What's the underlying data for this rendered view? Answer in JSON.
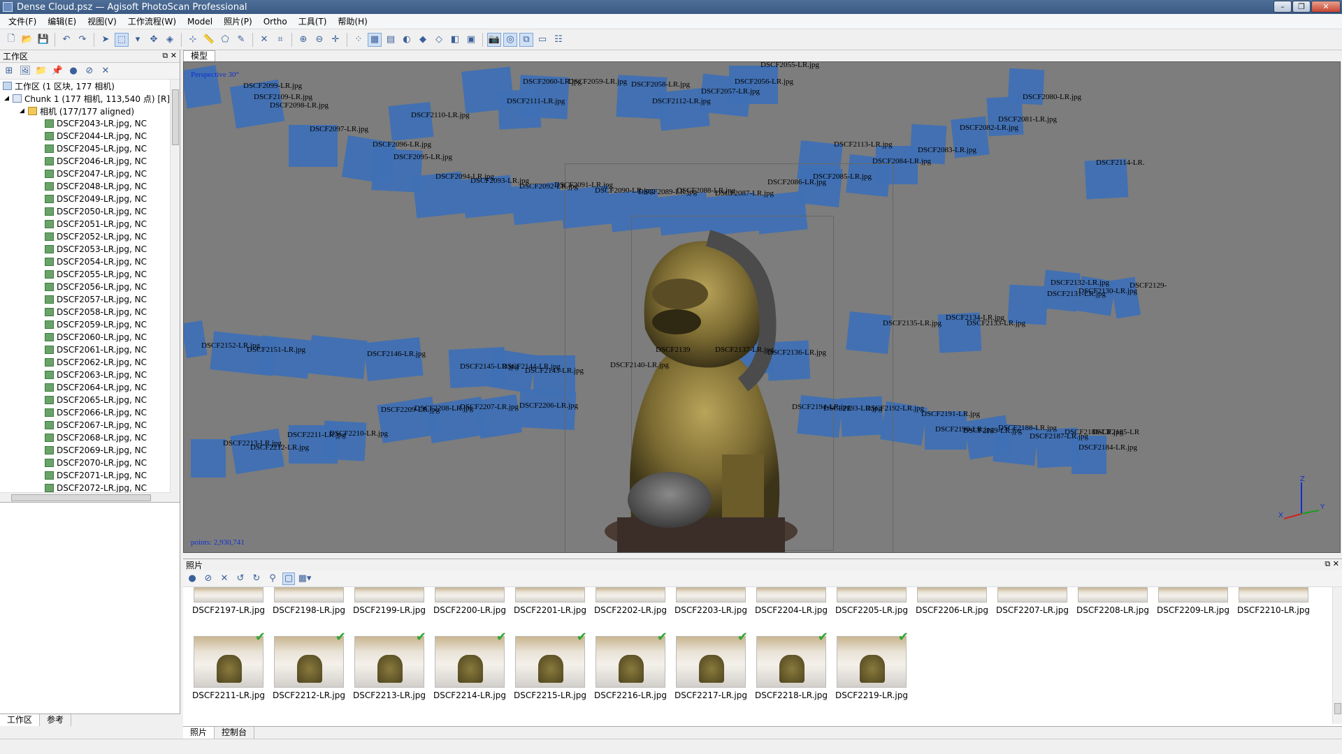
{
  "window": {
    "title": "Dense Cloud.psz — Agisoft PhotoScan Professional"
  },
  "menu": [
    "文件(F)",
    "编辑(E)",
    "视图(V)",
    "工作流程(W)",
    "Model",
    "照片(P)",
    "Ortho",
    "工具(T)",
    "帮助(H)"
  ],
  "workspace": {
    "title": "工作区",
    "root_label": "工作区 (1 区块, 177 相机)",
    "chunk_label": "Chunk 1 (177 相机, 113,540 点) [R]",
    "cameras_label": "相机 (177/177 aligned)",
    "cameras": [
      "DSCF2043-LR.jpg, NC",
      "DSCF2044-LR.jpg, NC",
      "DSCF2045-LR.jpg, NC",
      "DSCF2046-LR.jpg, NC",
      "DSCF2047-LR.jpg, NC",
      "DSCF2048-LR.jpg, NC",
      "DSCF2049-LR.jpg, NC",
      "DSCF2050-LR.jpg, NC",
      "DSCF2051-LR.jpg, NC",
      "DSCF2052-LR.jpg, NC",
      "DSCF2053-LR.jpg, NC",
      "DSCF2054-LR.jpg, NC",
      "DSCF2055-LR.jpg, NC",
      "DSCF2056-LR.jpg, NC",
      "DSCF2057-LR.jpg, NC",
      "DSCF2058-LR.jpg, NC",
      "DSCF2059-LR.jpg, NC",
      "DSCF2060-LR.jpg, NC",
      "DSCF2061-LR.jpg, NC",
      "DSCF2062-LR.jpg, NC",
      "DSCF2063-LR.jpg, NC",
      "DSCF2064-LR.jpg, NC",
      "DSCF2065-LR.jpg, NC",
      "DSCF2066-LR.jpg, NC",
      "DSCF2067-LR.jpg, NC",
      "DSCF2068-LR.jpg, NC",
      "DSCF2069-LR.jpg, NC",
      "DSCF2070-LR.jpg, NC",
      "DSCF2071-LR.jpg, NC",
      "DSCF2072-LR.jpg, NC"
    ],
    "tabs": [
      "工作区",
      "参考"
    ]
  },
  "model_view": {
    "tab": "模型",
    "perspective": "Perspective 30°",
    "points": "points: 2,930,741",
    "axis_labels": [
      "Z",
      "Y",
      "X"
    ],
    "camera_labels": [
      "DSCF2099-LR.jpg",
      "DSCF2109-LR.jpg",
      "DSCF2098-LR.jpg",
      "DSCF2110-LR.jpg",
      "DSCF2097-LR.jpg",
      "DSCF2096-LR.jpg",
      "DSCF2095-LR.jpg",
      "DSCF2094-LR.jpg",
      "DSCF2093-LR.jpg",
      "DSCF2092-LR.jpg",
      "DSCF2091-LR.jpg",
      "DSCF2090-LR.jpg",
      "DSCF2089-LR.jpg",
      "DSCF2088-LR.jpg",
      "DSCF2087-LR.jpg",
      "DSCF2060-LR.jpg",
      "DSCF2059-LR.jpg",
      "DSCF2111-LR.jpg",
      "DSCF2058-LR.jpg",
      "DSCF2112-LR.jpg",
      "DSCF2057-LR.jpg",
      "DSCF2056-LR.jpg",
      "DSCF2055-LR.jpg",
      "DSCF2080-LR.jpg",
      "DSCF2081-LR.jpg",
      "DSCF2082-LR.jpg",
      "DSCF2113-LR.jpg",
      "DSCF2083-LR.jpg",
      "DSCF2084-LR.jpg",
      "DSCF2085-LR.jpg",
      "DSCF2086-LR.jpg",
      "DSCF2114-LR.",
      "DSCF2132-LR.jpg",
      "DSCF2131-LR.jpg",
      "DSCF2130-LR.jpg",
      "DSCF2129-",
      "DSCF2134-LR.jpg",
      "DSCF2135-LR.jpg",
      "DSCF2133-LR.jpg",
      "DSCF2152-LR.jpg",
      "DSCF2151-LR.jpg",
      "DSCF2146-LR.jpg",
      "DSCF2145-LR.jpg",
      "DSCF2144-LR.jpg",
      "DSCF2143-LR.jpg",
      "DSCF2140-LR.jpg",
      "DSCF2139",
      "DSCF2137-LR.jpg",
      "DSCF2136-LR.jpg",
      "DSCF2207-LR.jpg",
      "DSCF2208-LR.jpg",
      "DSCF2209-LR.jpg",
      "DSCF2206-LR.jpg",
      "DSCF2194-LR.jpg",
      "DSCF2193-LR.jpg",
      "DSCF2192-LR.jpg",
      "DSCF2191-LR.jpg",
      "DSCF2190-LR.jpg",
      "DSCF2189-LR.jpg",
      "DSCF2188-LR.jpg",
      "DSCF2187-LR.jpg",
      "DSCF2186-LR.jpg",
      "DSCF2185-LR",
      "DSCF2184-LR.jpg",
      "DSCF2211-LR.jpg",
      "DSCF2210-LR.jpg",
      "DSCF2213-LR.jpg",
      "DSCF2212-LR.jpg"
    ]
  },
  "photos": {
    "title": "照片",
    "row1": [
      "DSCF2197-LR.jpg",
      "DSCF2198-LR.jpg",
      "DSCF2199-LR.jpg",
      "DSCF2200-LR.jpg",
      "DSCF2201-LR.jpg",
      "DSCF2202-LR.jpg",
      "DSCF2203-LR.jpg",
      "DSCF2204-LR.jpg",
      "DSCF2205-LR.jpg",
      "DSCF2206-LR.jpg",
      "DSCF2207-LR.jpg",
      "DSCF2208-LR.jpg",
      "DSCF2209-LR.jpg",
      "DSCF2210-LR.jpg"
    ],
    "row2": [
      "DSCF2211-LR.jpg",
      "DSCF2212-LR.jpg",
      "DSCF2213-LR.jpg",
      "DSCF2214-LR.jpg",
      "DSCF2215-LR.jpg",
      "DSCF2216-LR.jpg",
      "DSCF2217-LR.jpg",
      "DSCF2218-LR.jpg",
      "DSCF2219-LR.jpg"
    ],
    "tabs": [
      "照片",
      "控制台"
    ]
  },
  "colors": {
    "camera_plane": "#3f70b5",
    "viewport_bg": "#7d7d7d",
    "annotation_text": "#1030d0",
    "check": "#31a531"
  }
}
